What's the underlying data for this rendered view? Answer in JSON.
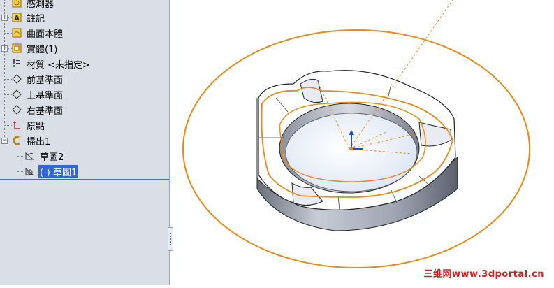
{
  "feature_tree": {
    "items": [
      {
        "label": "感測器",
        "icon": "sensor-icon"
      },
      {
        "label": "註記",
        "icon": "annotation-icon"
      },
      {
        "label": "曲面本體",
        "icon": "surface-bodies-icon"
      },
      {
        "label": "實體(1)",
        "icon": "solid-bodies-icon"
      },
      {
        "label": "材質 <未指定>",
        "icon": "material-icon"
      },
      {
        "label": "前基準面",
        "icon": "plane-icon"
      },
      {
        "label": "上基準面",
        "icon": "plane-icon"
      },
      {
        "label": "右基準面",
        "icon": "plane-icon"
      },
      {
        "label": "原點",
        "icon": "origin-icon"
      },
      {
        "label": "掃出1",
        "icon": "sweep-icon"
      },
      {
        "label": "草圖2",
        "icon": "sketch-icon"
      },
      {
        "label": "(-) 草圖1",
        "icon": "sketch-icon"
      }
    ]
  },
  "watermark": "三维网www.3dportal.cn",
  "colors": {
    "tree_bg": "#d9dee7",
    "selection": "#3465d8",
    "sketch_orange": "#e88a1a",
    "watermark_red": "#d32020"
  }
}
